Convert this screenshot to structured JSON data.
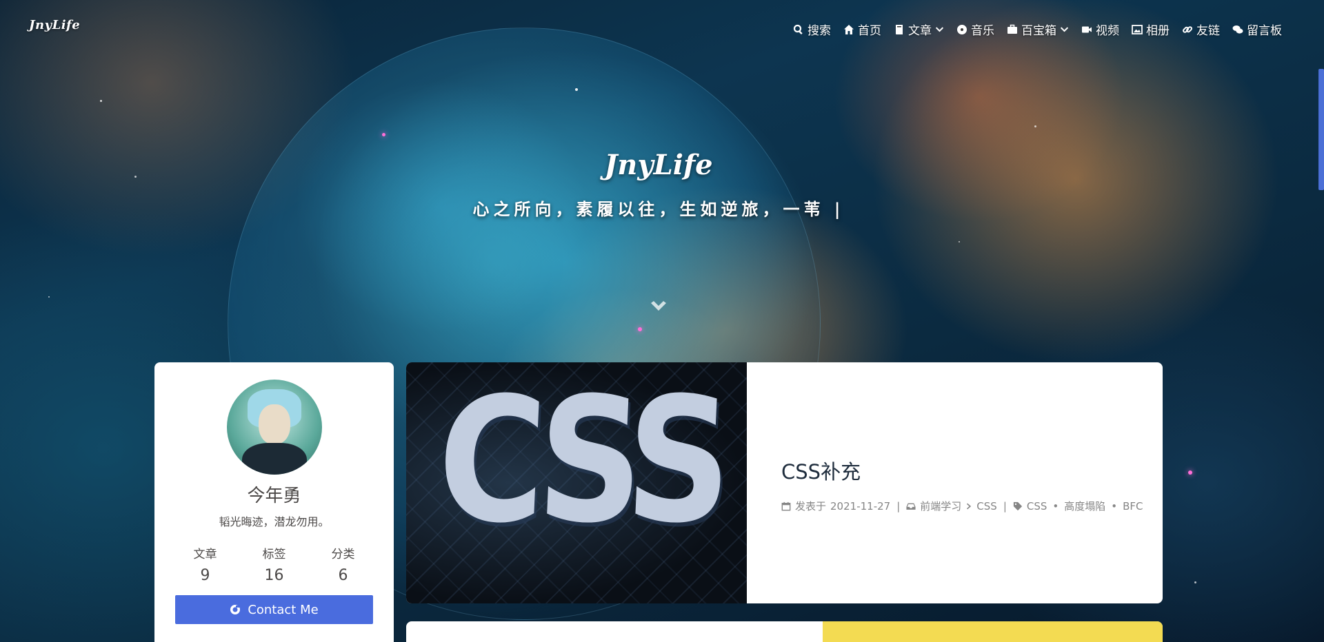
{
  "site": {
    "logo": "JnyLife",
    "title": "JnyLife",
    "subtitle": "心之所向，素履以往，生如逆旅，一苇 |"
  },
  "nav": {
    "items": [
      {
        "label": "搜索",
        "icon": "search-icon"
      },
      {
        "label": "首页",
        "icon": "home-icon"
      },
      {
        "label": "文章",
        "icon": "book-icon",
        "dropdown": true
      },
      {
        "label": "音乐",
        "icon": "disc-icon"
      },
      {
        "label": "百宝箱",
        "icon": "briefcase-icon",
        "dropdown": true
      },
      {
        "label": "视频",
        "icon": "video-icon"
      },
      {
        "label": "相册",
        "icon": "image-icon"
      },
      {
        "label": "友链",
        "icon": "link-icon"
      },
      {
        "label": "留言板",
        "icon": "comments-icon"
      }
    ]
  },
  "profile": {
    "name": "今年勇",
    "motto": "韬光晦迹，潜龙勿用。",
    "stats": [
      {
        "label": "文章",
        "value": "9"
      },
      {
        "label": "标签",
        "value": "16"
      },
      {
        "label": "分类",
        "value": "6"
      }
    ],
    "contact_label": "Contact Me"
  },
  "post": {
    "cover_text": "CSS",
    "title": "CSS补充",
    "date_prefix": "发表于",
    "date": "2021-11-27",
    "category_parent": "前端学习",
    "category_child": "CSS",
    "tags": [
      "CSS",
      "高度塌陷",
      "BFC"
    ]
  },
  "colors": {
    "accent": "#4a6cde",
    "post2_cover": "#f3db52"
  }
}
